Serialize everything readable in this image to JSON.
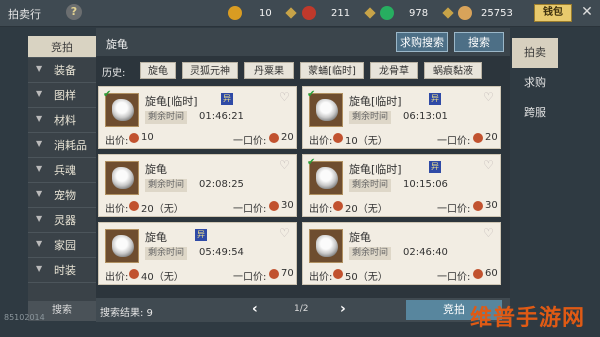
{
  "header": {
    "title": "拍卖行",
    "help_label": "?",
    "wallet_label": "钱包",
    "close_label": "✕"
  },
  "currencies": [
    {
      "icon": "gold-pouch-icon",
      "value": "10",
      "color": "#d99c22"
    },
    {
      "icon": "red-gem-icon",
      "value": "211",
      "color": "#c0392b"
    },
    {
      "icon": "green-jade-icon",
      "value": "978",
      "color": "#27ae60"
    },
    {
      "icon": "silver-coin-icon",
      "value": "25753",
      "color": "#d8a35a"
    }
  ],
  "sidebar": {
    "selected_label": "竞拍",
    "items": [
      "装备",
      "图样",
      "材料",
      "消耗品",
      "兵魂",
      "宠物",
      "灵器",
      "家园",
      "时装"
    ],
    "search_label": "搜索"
  },
  "panel": {
    "item_name": "旋龟",
    "want_buy_search": "求购搜索",
    "search": "搜索",
    "history_label": "历史:",
    "history": [
      "旋龟",
      "灵狐元神",
      "丹粟果",
      "蒙蛹[临时]",
      "龙骨草",
      "蜗痕黏液"
    ]
  },
  "cards": [
    {
      "name": "旋龟[临时]",
      "tag": "异",
      "time_label": "剩余时间",
      "time": "01:46:21",
      "price_label": "出价:",
      "price": "10",
      "buyout_label": "一口价:",
      "buyout": "20",
      "checked": true
    },
    {
      "name": "旋龟[临时]",
      "tag": "异",
      "time_label": "剩余时间",
      "time": "06:13:01",
      "price_label": "出价:",
      "price": "10（无）",
      "buyout_label": "一口价:",
      "buyout": "20",
      "checked": true
    },
    {
      "name": "旋龟",
      "tag": "",
      "time_label": "剩余时间",
      "time": "02:08:25",
      "price_label": "出价:",
      "price": "20（无）",
      "buyout_label": "一口价:",
      "buyout": "30",
      "checked": false
    },
    {
      "name": "旋龟[临时]",
      "tag": "异",
      "time_label": "剩余时间",
      "time": "10:15:06",
      "price_label": "出价:",
      "price": "20（无）",
      "buyout_label": "一口价:",
      "buyout": "30",
      "checked": true
    },
    {
      "name": "旋龟",
      "tag": "异",
      "time_label": "剩余时间",
      "time": "05:49:54",
      "price_label": "出价:",
      "price": "40（无）",
      "buyout_label": "一口价:",
      "buyout": "70",
      "checked": false
    },
    {
      "name": "旋龟",
      "tag": "",
      "time_label": "剩余时间",
      "time": "02:46:40",
      "price_label": "出价:",
      "price": "50（无）",
      "buyout_label": "一口价:",
      "buyout": "60",
      "checked": false
    }
  ],
  "bottom": {
    "results_label": "搜索结果: 9",
    "page": "1/2",
    "prev": "‹",
    "next": "›",
    "buy_label": "竞拍"
  },
  "right_tabs": [
    "拍卖",
    "求购",
    "跨服"
  ],
  "coord_text": "85102014",
  "watermark": "维普手游网"
}
